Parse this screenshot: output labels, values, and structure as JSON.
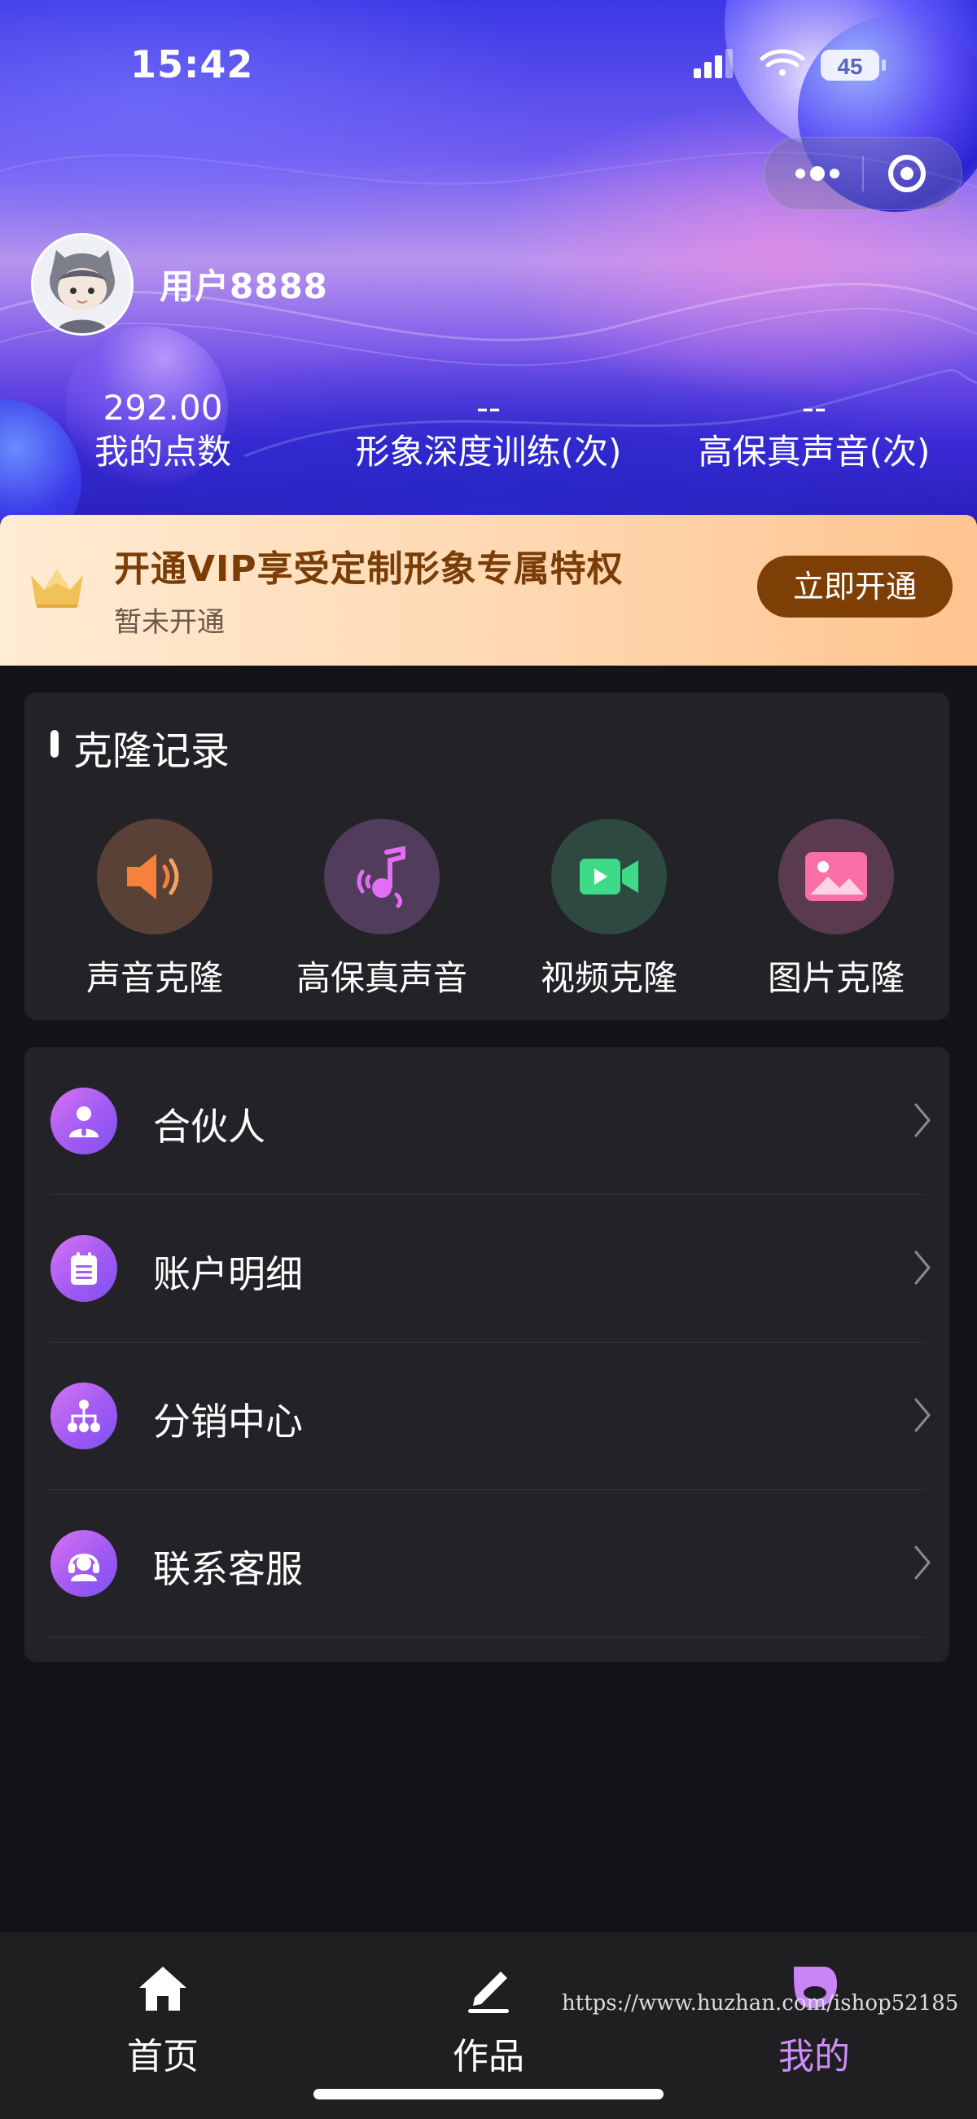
{
  "status_bar": {
    "time": "15:42",
    "battery": "45",
    "icons": [
      "cellular-icon",
      "wifi-icon",
      "battery-icon"
    ]
  },
  "mini_program_capsule": {
    "icons": [
      "more-dots-icon",
      "close-target-icon"
    ]
  },
  "profile": {
    "username": "用户8888",
    "avatar_icon": "cartoon-avatar"
  },
  "stats": [
    {
      "value": "292.00",
      "label": "我的点数"
    },
    {
      "value": "--",
      "label": "形象深度训练(次)"
    },
    {
      "value": "--",
      "label": "高保真声音(次)"
    }
  ],
  "vip": {
    "title": "开通VIP享受定制形象专属特权",
    "subtitle": "暂未开通",
    "button_label": "立即开通",
    "icon": "crown-icon"
  },
  "clone_records": {
    "title": "克隆记录",
    "items": [
      {
        "label": "声音克隆",
        "icon": "speaker-icon"
      },
      {
        "label": "高保真声音",
        "icon": "music-note-icon"
      },
      {
        "label": "视频克隆",
        "icon": "video-camera-icon"
      },
      {
        "label": "图片克隆",
        "icon": "picture-icon"
      }
    ]
  },
  "menu": [
    {
      "label": "合伙人",
      "icon": "partner-icon"
    },
    {
      "label": "账户明细",
      "icon": "clipboard-icon"
    },
    {
      "label": "分销中心",
      "icon": "hierarchy-icon"
    },
    {
      "label": "联系客服",
      "icon": "headset-icon"
    }
  ],
  "tabbar": [
    {
      "label": "首页",
      "icon": "home-icon",
      "active": false
    },
    {
      "label": "作品",
      "icon": "pencil-icon",
      "active": false
    },
    {
      "label": "我的",
      "icon": "profile-icon",
      "active": true
    }
  ],
  "watermark": "https://www.huzhan.com/ishop52185",
  "colors": {
    "accent": "#cf8df5",
    "vip_button": "#7e3f06",
    "vip_title": "#7a3d07",
    "card_bg": "#222227",
    "page_bg": "#141418"
  }
}
